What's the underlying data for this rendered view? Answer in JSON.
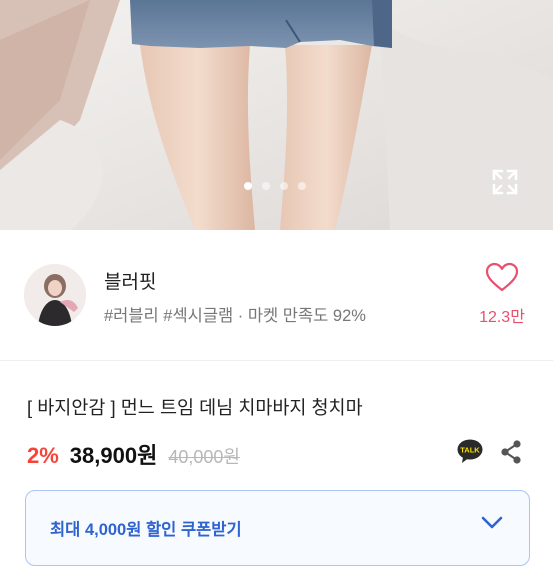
{
  "gallery": {
    "total_images": 4,
    "current_index": 1,
    "expand_icon": "expand-icon"
  },
  "shop": {
    "name": "블러핏",
    "tags": "#러블리 #섹시글램 · 마켓 만족도 92%",
    "like_count": "12.3만",
    "like_icon": "heart-outline-icon",
    "like_color": "#e8506e"
  },
  "product": {
    "title": "[ 바지안감 ] 먼느 트임 데님 치마바지 청치마",
    "discount": "2%",
    "price": "38,900원",
    "original_price": "40,000원",
    "discount_color": "#f5453a"
  },
  "actions": {
    "talk_label": "TALK",
    "share_icon": "share-icon"
  },
  "coupon": {
    "label": "최대 4,000원 할인 쿠폰받기",
    "accent_color": "#2f63d0",
    "chevron_icon": "chevron-down-icon"
  }
}
